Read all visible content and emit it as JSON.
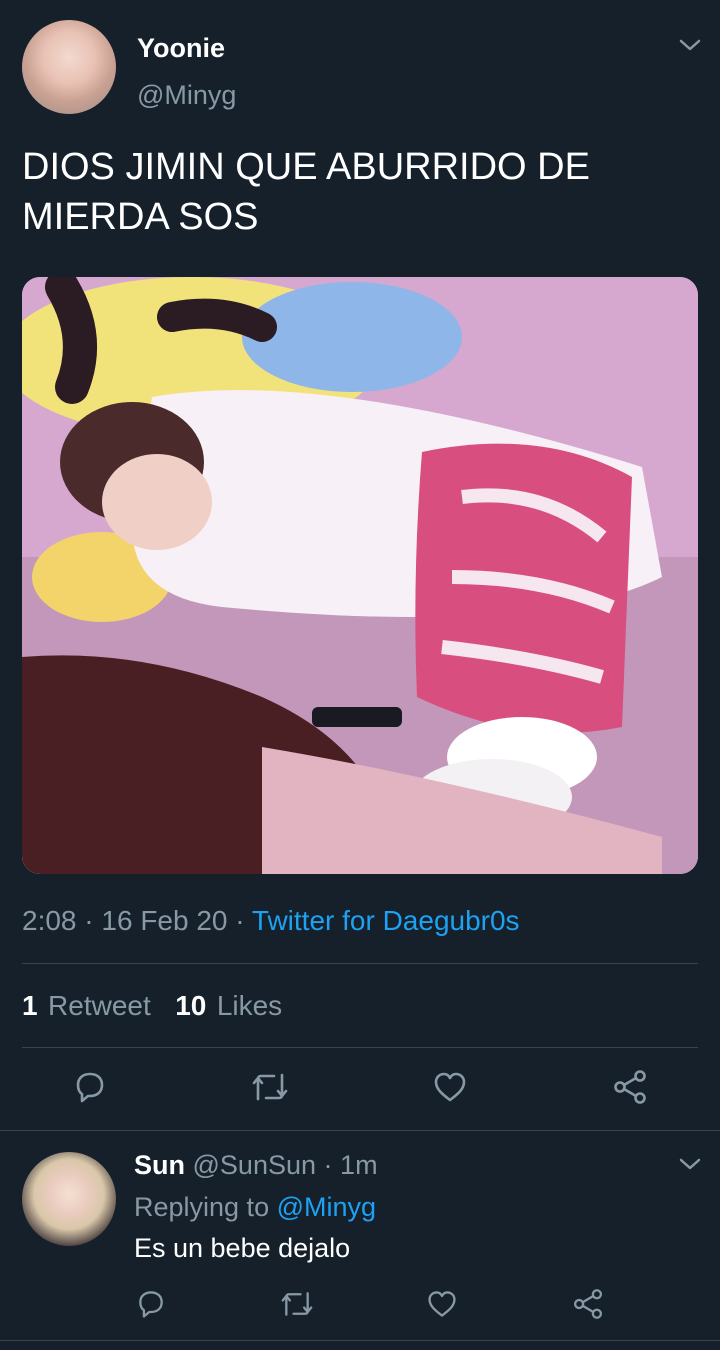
{
  "tweet": {
    "author_name": "Yoonie",
    "author_handle": "@Minyg",
    "text": "DIOS JIMIN QUE ABURRIDO DE MIERDA SOS",
    "time": "2:08",
    "date": "16 Feb 20",
    "separator": "·",
    "source": "Twitter for Daegubr0s",
    "retweet_count": "1",
    "retweet_label": "Retweet",
    "like_count": "10",
    "like_label": "Likes"
  },
  "reply": {
    "author_name": "Sun",
    "author_handle": "@SunSun",
    "time": "1m",
    "separator": "·",
    "replying_to_label": "Replying to",
    "replying_to_handle": "@Minyg",
    "text": "Es un bebe dejalo"
  },
  "icons": {
    "action_color": "#8899a6",
    "link_color": "#1da1f2",
    "names": [
      "chevron-down-icon",
      "reply-icon",
      "retweet-icon",
      "like-icon",
      "share-icon"
    ]
  }
}
